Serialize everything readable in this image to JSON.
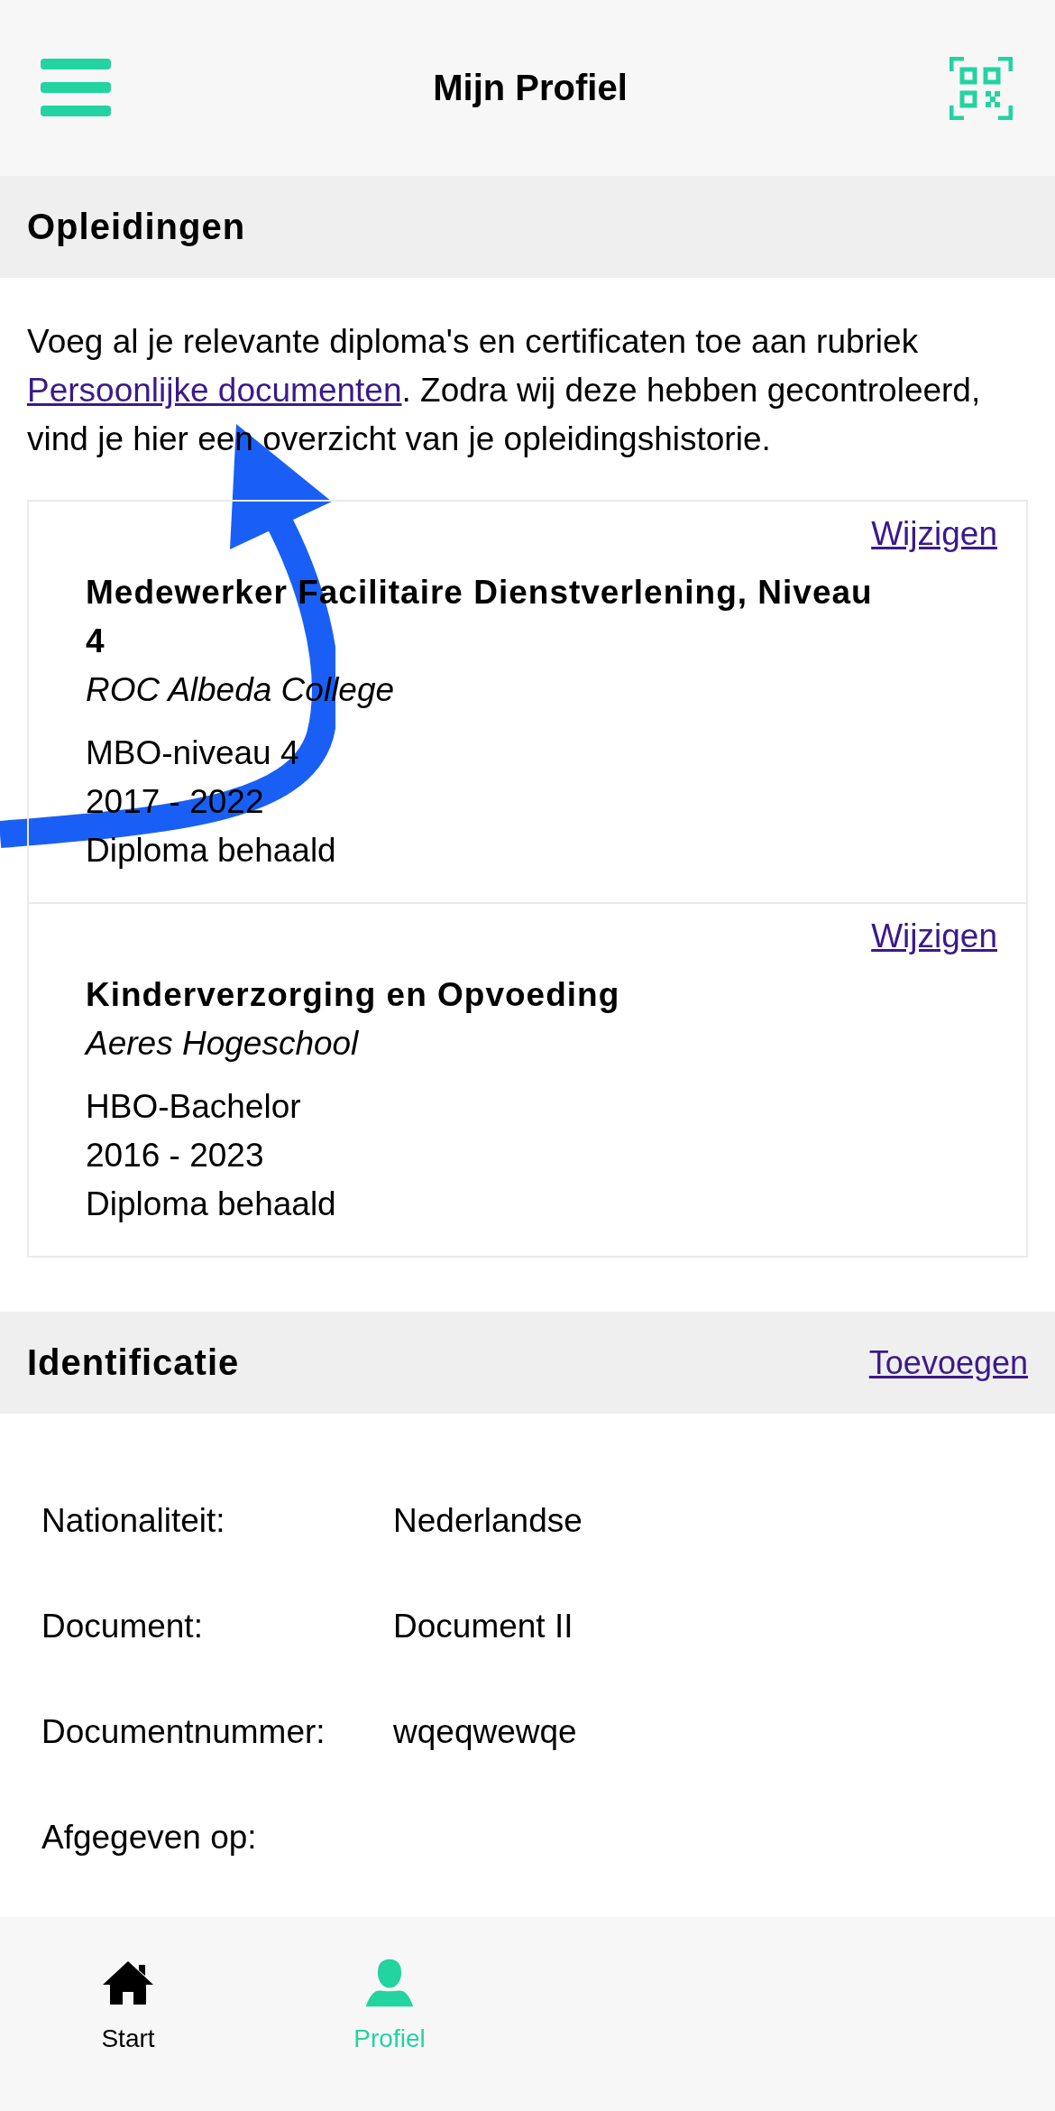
{
  "header": {
    "title": "Mijn Profiel"
  },
  "education": {
    "title": "Opleidingen",
    "intro_before": "Voeg al je relevante diploma's en certificaten toe aan rubriek ",
    "intro_link": "Persoonlijke documenten",
    "intro_after": ". Zodra wij deze hebben gecontroleerd, vind je hier een overzicht van je opleidingshistorie.",
    "items": [
      {
        "action": "Wijzigen",
        "name": "Medewerker Facilitaire Dienstverlening, Niveau 4",
        "school": "ROC Albeda College",
        "degree": "MBO-niveau 4",
        "period": "2017 - 2022",
        "status": "Diploma behaald"
      },
      {
        "action": "Wijzigen",
        "name": "Kinderverzorging en Opvoeding",
        "school": "Aeres Hogeschool",
        "degree": "HBO-Bachelor",
        "period": "2016 - 2023",
        "status": "Diploma behaald"
      }
    ]
  },
  "identification": {
    "title": "Identificatie",
    "action": "Toevoegen",
    "rows": [
      {
        "label": "Nationaliteit:",
        "value": "Nederlandse"
      },
      {
        "label": "Document:",
        "value": "Document II"
      },
      {
        "label": "Documentnummer:",
        "value": "wqeqwewqe"
      },
      {
        "label": "Afgegeven op:"
      }
    ]
  },
  "tab_bar": {
    "tabs": [
      {
        "kind": "home",
        "label": "Start",
        "selected": false
      },
      {
        "kind": "person",
        "label": "Profiel",
        "selected": true
      }
    ]
  }
}
